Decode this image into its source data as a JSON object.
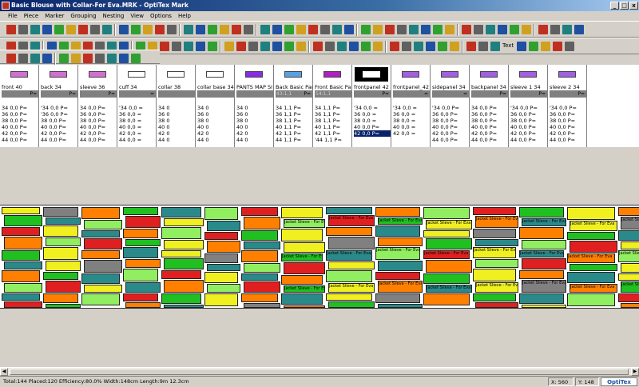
{
  "window": {
    "title": "Basic Blouse with Collar-For Eva.MRK - OptiTex Mark"
  },
  "menu": [
    "File",
    "Piece",
    "Marker",
    "Grouping",
    "Nesting",
    "View",
    "Options",
    "Help"
  ],
  "toolbar": {
    "text_label": "Text"
  },
  "pieces": [
    {
      "name": "front 40",
      "sub": "",
      "p": "P=",
      "color": "#d070d0",
      "sizes": [
        "34 0,0 P=",
        "36 0,0 P=",
        "38 0,0 P=",
        "40 0,0 P=",
        "42 0,0 P=",
        "44 0,0 P="
      ]
    },
    {
      "name": "back 34",
      "sub": "",
      "p": "P=",
      "color": "#d070d0",
      "sizes": [
        "'34 0,0 P=",
        "'36 0,0 P=",
        "38 0,0 P=",
        "40 0,0 P=",
        "42 0,0 P=",
        "44 0,0 P="
      ]
    },
    {
      "name": "sleeve 36",
      "sub": "",
      "p": "P=",
      "color": "#d070d0",
      "sizes": [
        "34 0,0 P=",
        "36 0,0 P=",
        "38 0,0 P=",
        "40 0,0 P=",
        "42 0,0 P=",
        "44 0,0 P="
      ]
    },
    {
      "name": "cuff 34",
      "sub": "",
      "p": "=",
      "color": "#ffffff",
      "sizes": [
        "'34 0,0 =",
        "36 0,0 =",
        "38 0,0 =",
        "40 0,0 =",
        "42 0,0 =",
        "44 0,0 ="
      ]
    },
    {
      "name": "collar 38",
      "sub": "",
      "p": "",
      "color": "#ffffff",
      "sizes": [
        "34 0",
        "36 0",
        "38 0",
        "40 0",
        "42 0",
        "44 0"
      ]
    },
    {
      "name": "collar base 34",
      "sub": "",
      "p": "",
      "color": "#ffffff",
      "sizes": [
        "34 0",
        "36 0",
        "38 0",
        "40 0",
        "42 0",
        "44 0"
      ]
    },
    {
      "name": "PANTS MAP SI",
      "sub": "",
      "p": "",
      "color": "#8a2be2",
      "sizes": [
        "34 0",
        "36 0",
        "38 0",
        "40 0",
        "42 0",
        "44 0"
      ]
    },
    {
      "name": "Back Basic Pant",
      "sub": "43:1,1",
      "p": "P=",
      "color": "#5aa0e0",
      "sizes": [
        "34 1,1 P=",
        "36 1,1 P=",
        "38 1,1 P=",
        "40 1,1 P=",
        "42 1,1 P=",
        "44 1,1 P="
      ]
    },
    {
      "name": "Front Basic Pan",
      "sub": "54:1,1",
      "p": "",
      "color": "#b020c0",
      "sizes": [
        "34 1,1 P=",
        "36 1,1 P=",
        "38 1,1 P=",
        "40 1,1 P=",
        "42 1,1 P=",
        "'44 1,1 P="
      ]
    },
    {
      "name": "frontpanel 42",
      "sub": "",
      "p": "P=",
      "color": "#ffffff",
      "selected": true,
      "sizes": [
        "'34 0,0 =",
        "36 0,0 =",
        "38 0,0 =",
        "40 0,0 P=",
        "42 0,0 P="
      ]
    },
    {
      "name": "frontpanel_42 3",
      "sub": "",
      "p": "=",
      "color": "#a060e0",
      "sizes": [
        "'34 0,0 =",
        "36 0,0 =",
        "38 0,0 =",
        "40 0,0 =",
        "42 0,0 ="
      ]
    },
    {
      "name": "sidepanel 34",
      "sub": "",
      "p": "=",
      "color": "#a060e0",
      "sizes": [
        "'34 0,0 P=",
        "36 0,0 P=",
        "38 0,0 P=",
        "40 0,0 P=",
        "42 0,0 P=",
        "44 0,0 P="
      ]
    },
    {
      "name": "backpanel 34",
      "sub": "",
      "p": "P=",
      "color": "#a060e0",
      "sizes": [
        "34 0,0 P=",
        "36 0,0 P=",
        "38 0,0 P=",
        "40 0,0 P=",
        "42 0,0 P=",
        "44 0,0 P="
      ]
    },
    {
      "name": "sleeve 1 34",
      "sub": "",
      "p": "P=",
      "color": "#a060e0",
      "sizes": [
        "'34 0,0 P=",
        "36 0,0 P=",
        "38 0,0 P=",
        "40 0,0 P=",
        "42 0,0 P=",
        "44 0,0 P="
      ]
    },
    {
      "name": "sleeve 2 34",
      "sub": "",
      "p": "P=",
      "color": "#a060e0",
      "sizes": [
        "'34 0,0 P=",
        "36 0,0 P=",
        "38 0,0 P=",
        "40 0,0 P=",
        "42 0,0 P=",
        "44 0,0 P="
      ]
    }
  ],
  "marker_label": "Jacket Slieve - For Eva",
  "marker_colors": [
    "#f0f020",
    "#808080",
    "#ff8000",
    "#20c020",
    "#2a8a8a",
    "#90ee60",
    "#e02020",
    "#f0f020",
    "#2a8a8a",
    "#ff8000",
    "#90ee60",
    "#e02020",
    "#20c020",
    "#f0f020",
    "#ff8000",
    "#2a8a8a"
  ],
  "status": {
    "stats": "Total:144  Placed:120  Efficiency:80.0%  Width:148cm  Length:9m 12.3cm",
    "x": "X: 560",
    "y": "Y: 148",
    "logo": "OptiTex"
  }
}
